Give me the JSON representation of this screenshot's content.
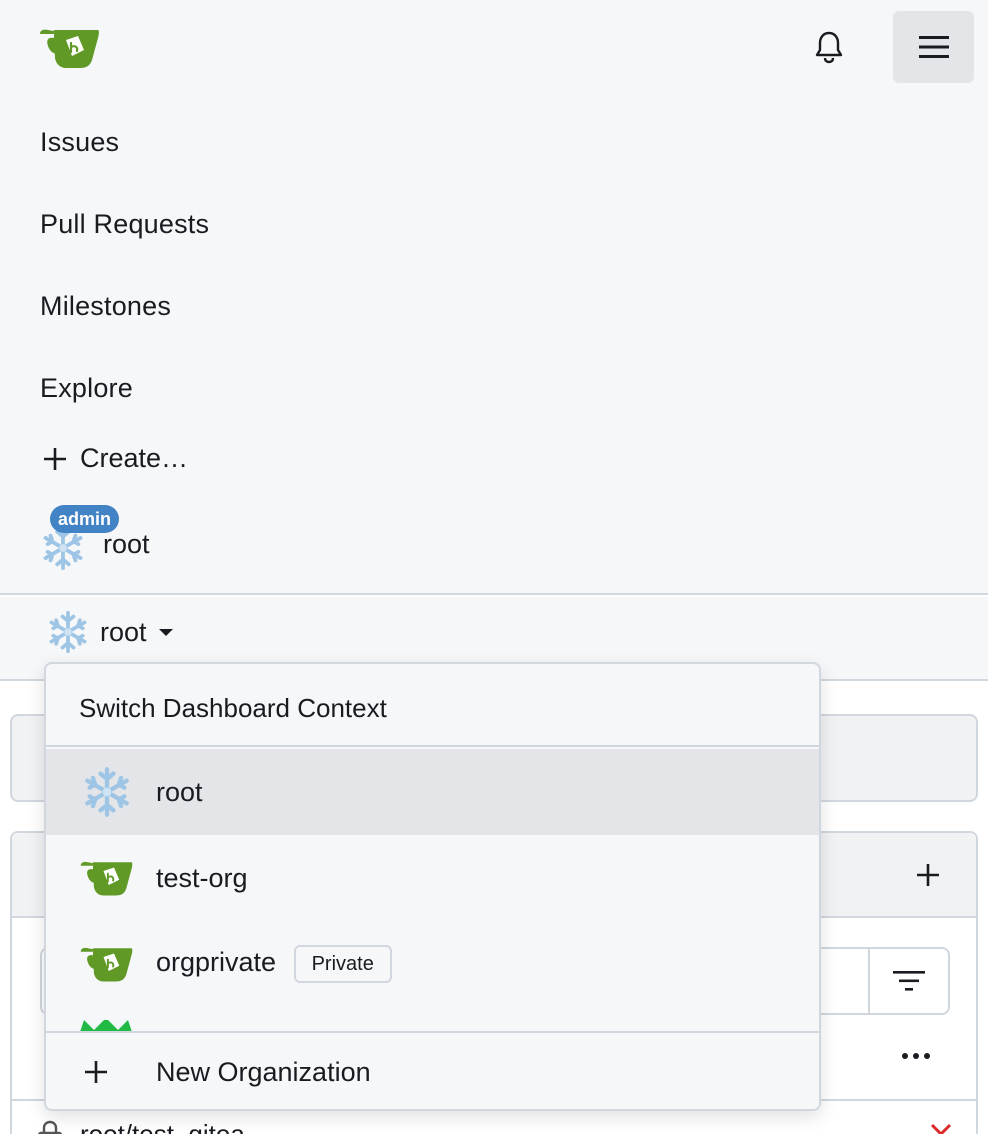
{
  "nav": {
    "links": [
      "Issues",
      "Pull Requests",
      "Milestones",
      "Explore"
    ],
    "create_label": "Create…",
    "user": {
      "name": "root",
      "badge": "admin"
    }
  },
  "context": {
    "current": "root",
    "menu": {
      "header": "Switch Dashboard Context",
      "items": [
        {
          "name": "root",
          "icon": "snowflake-avatar-icon",
          "active": true
        },
        {
          "name": "test-org",
          "icon": "gitea-logo-icon"
        },
        {
          "name": "orgprivate",
          "icon": "gitea-logo-icon",
          "badge": "Private"
        }
      ],
      "footer": "New Organization"
    }
  },
  "background": {
    "repo_name": "root/test_gitea"
  },
  "colors": {
    "brand_green": "#609926",
    "admin_badge": "#4183c4",
    "nav_bg": "#f6f7f9",
    "error_red": "#db2828"
  }
}
